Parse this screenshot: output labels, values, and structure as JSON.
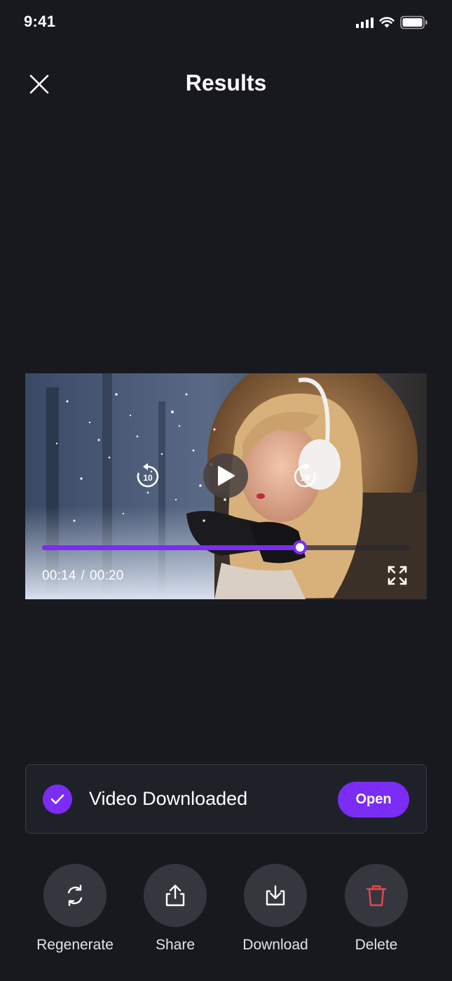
{
  "status_bar": {
    "time": "9:41"
  },
  "header": {
    "title": "Results",
    "close_icon": "close-icon"
  },
  "video": {
    "current_time": "00:14",
    "separator": "/",
    "duration": "00:20",
    "progress": 0.7,
    "rewind_seconds": "10",
    "forward_seconds": "10",
    "accent": "#7b2cf5"
  },
  "toast": {
    "message": "Video Downloaded",
    "open_label": "Open"
  },
  "actions": [
    {
      "label": "Regenerate",
      "icon": "refresh-icon"
    },
    {
      "label": "Share",
      "icon": "share-icon"
    },
    {
      "label": "Download",
      "icon": "download-icon"
    },
    {
      "label": "Delete",
      "icon": "trash-icon",
      "color": "#e5484d"
    }
  ]
}
